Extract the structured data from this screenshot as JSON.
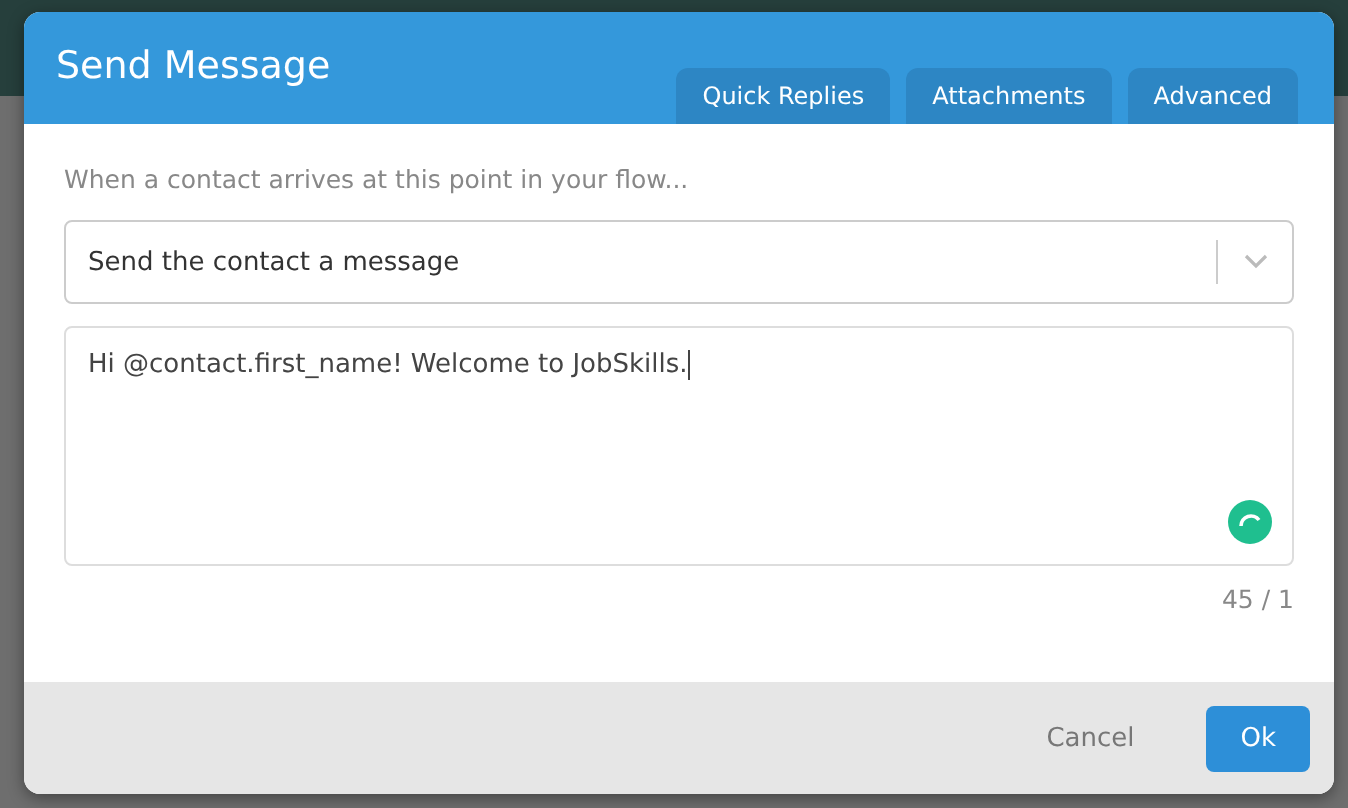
{
  "dialog": {
    "title": "Send Message",
    "tabs": [
      {
        "label": "Quick Replies"
      },
      {
        "label": "Attachments"
      },
      {
        "label": "Advanced"
      }
    ],
    "prompt": "When a contact arrives at this point in your flow...",
    "action_select": {
      "value": "Send the contact a message"
    },
    "message": {
      "value": "Hi @contact.first_name! Welcome to JobSkills.",
      "counter": "45 / 1"
    },
    "buttons": [
      {
        "label": "Cancel",
        "kind": "secondary"
      },
      {
        "label": "Ok",
        "kind": "primary"
      }
    ]
  }
}
